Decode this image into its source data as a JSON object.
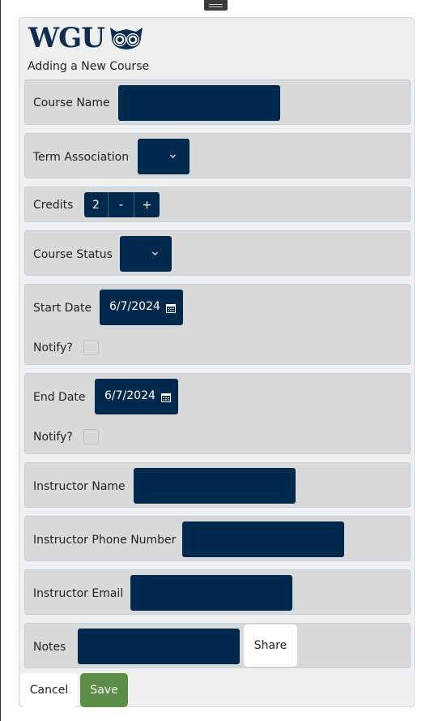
{
  "app": {
    "logo_text": "WGU",
    "subtitle": "Adding a New Course"
  },
  "form": {
    "course_name": {
      "label": "Course Name",
      "value": ""
    },
    "term_association": {
      "label": "Term Association",
      "value": ""
    },
    "credits": {
      "label": "Credits",
      "value": "2",
      "decrement": "-",
      "increment": "+"
    },
    "course_status": {
      "label": "Course Status",
      "value": ""
    },
    "start_date": {
      "label": "Start Date",
      "value": "6/7/2024",
      "notify_label": "Notify?",
      "notify_checked": false
    },
    "end_date": {
      "label": "End Date",
      "value": "6/7/2024",
      "notify_label": "Notify?",
      "notify_checked": false
    },
    "instructor_name": {
      "label": "Instructor Name",
      "value": ""
    },
    "instructor_phone": {
      "label": "Instructor Phone Number",
      "value": ""
    },
    "instructor_email": {
      "label": "Instructor Email",
      "value": ""
    },
    "notes": {
      "label": "Notes",
      "value": "",
      "share_label": "Share"
    }
  },
  "actions": {
    "cancel_label": "Cancel",
    "save_label": "Save"
  },
  "colors": {
    "brand_navy": "#0d2d50",
    "input_navy": "#002a4d",
    "save_green": "#5a8e46",
    "row_gray": "#d9d9d9"
  },
  "icons": {
    "dropdown": "chevron-down-icon",
    "date": "calendar-icon",
    "logo": "owl-icon"
  }
}
